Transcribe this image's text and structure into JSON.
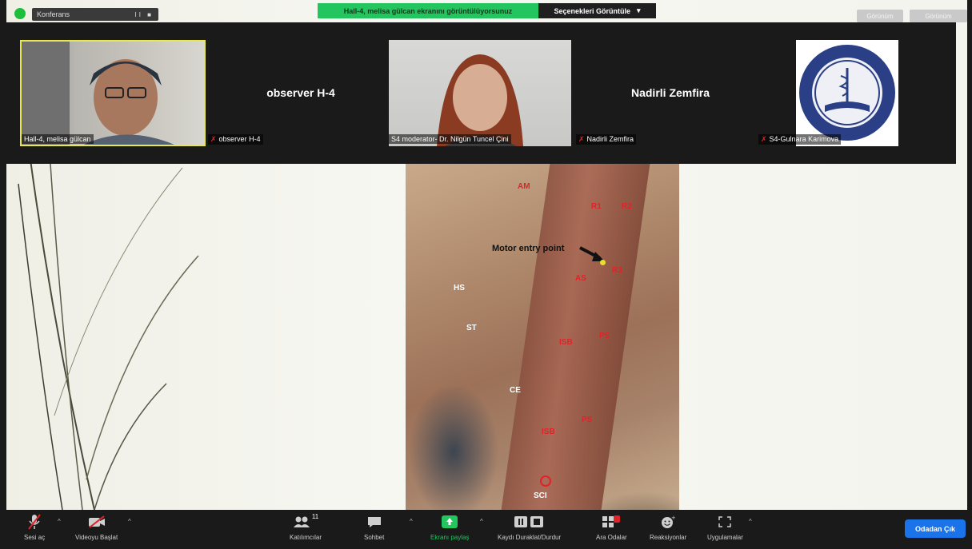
{
  "top_bar": {
    "view_pill_label": "Konferans",
    "view_pill_controls": "II ■",
    "speaking_banner": "Hall-4, melisa gülcan ekranını görüntülüyorsunuz",
    "view_options_label": "Seçenekleri Görüntüle",
    "view_options_caret": "▾",
    "right_button_1": "Görünüm",
    "right_button_2": "Görünüm"
  },
  "gallery": {
    "tiles": [
      {
        "label": "Hall-4, melisa gülcan",
        "muted": false
      },
      {
        "name": "observer H-4",
        "label": "observer H-4",
        "muted": true
      },
      {
        "label": "S4 moderator- Dr. Nilgün Tuncel Çini",
        "muted": false
      },
      {
        "name": "Nadirli Zemfira",
        "label": "Nadirli Zemfira",
        "muted": true
      },
      {
        "label": "S4-Gulnara Karimova",
        "muted": true
      }
    ]
  },
  "slide": {
    "motor_entry_label": "Motor entry point",
    "labels": {
      "am": "AM",
      "hs": "HS",
      "st": "ST",
      "ce": "CE",
      "sci": "SCI",
      "r1": "R1",
      "r2": "R2",
      "as": "AS",
      "isb": "ISB",
      "ps": "PS",
      "r3": "ISB",
      "r4": "PS",
      "r5": "R3"
    }
  },
  "toolbar": {
    "mute_label": "Sesi aç",
    "video_label": "Videoyu Başlat",
    "participants_label": "Katılımcılar",
    "participants_count": "11",
    "chat_label": "Sohbet",
    "share_label": "Ekranı paylaş",
    "record_label": "Kaydı Duraklat/Durdur",
    "rooms_label": "Ara Odalar",
    "reactions_label": "Reaksiyonlar",
    "apps_label": "Uygulamalar",
    "leave_label": "Odadan Çık",
    "caret": "^"
  },
  "colors": {
    "accent_green": "#22c55e",
    "leave_blue": "#1a73e8",
    "muted_red": "#e0232a"
  }
}
